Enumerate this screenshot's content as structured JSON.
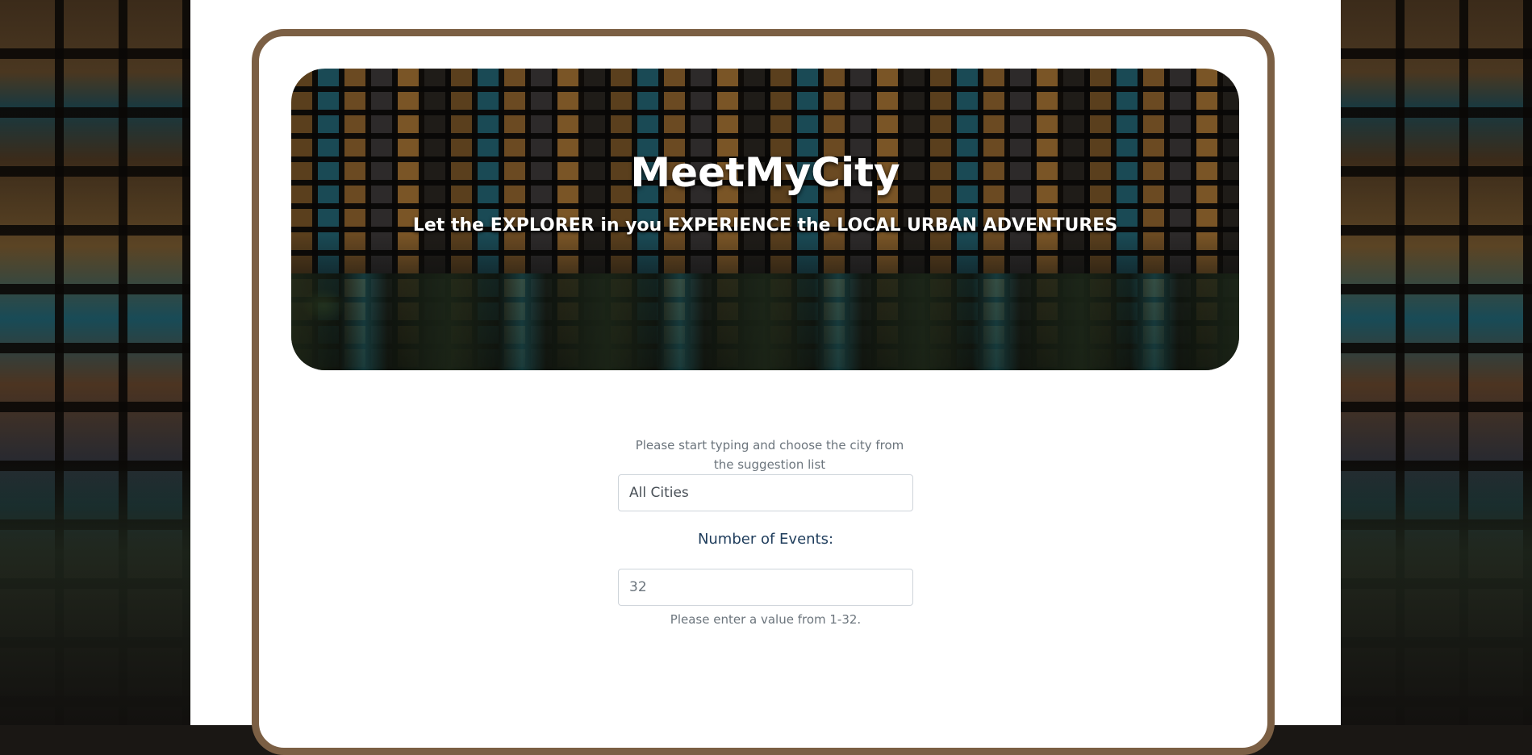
{
  "hero": {
    "title": "MeetMyCity",
    "subtitle": "Let the EXPLORER in you EXPERIENCE the LOCAL URBAN ADVENTURES"
  },
  "city_search": {
    "hint": "Please start typing and choose the city from the suggestion list",
    "value": "All Cities"
  },
  "number_of_events": {
    "label": "Number of Events:",
    "value": "32",
    "hint": "Please enter a value from 1-32."
  },
  "colors": {
    "frame_border": "#7b5f44",
    "label_text": "#1f3d5c",
    "hint_text": "#6c757d"
  }
}
